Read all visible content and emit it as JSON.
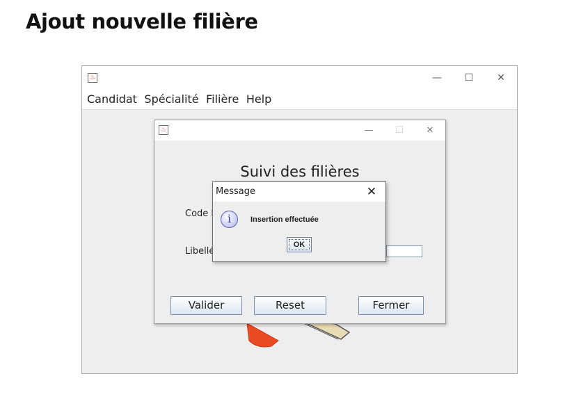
{
  "slide": {
    "title": "Ajout nouvelle filière"
  },
  "main_window": {
    "controls": {
      "minimize": "—",
      "maximize": "☐",
      "close": "✕"
    },
    "menu": [
      "Candidat",
      "Spécialité",
      "Filière",
      "Help"
    ]
  },
  "form_window": {
    "controls": {
      "minimize": "—",
      "maximize": "☐",
      "close": "✕"
    },
    "title": "Suivi des filières",
    "code_label": "Code F",
    "libelle_label": "Libellé",
    "buttons": {
      "valider": "Valider",
      "reset": "Reset",
      "fermer": "Fermer"
    }
  },
  "message_dialog": {
    "title": "Message",
    "close": "✕",
    "icon": "info-icon",
    "info_glyph": "i",
    "text": "Insertion effectuée",
    "ok": "OK"
  },
  "colors": {
    "window_bg": "#eeeeee",
    "button_gradient_bottom": "#dbe7f3",
    "info_icon": "#c4c9f3"
  }
}
